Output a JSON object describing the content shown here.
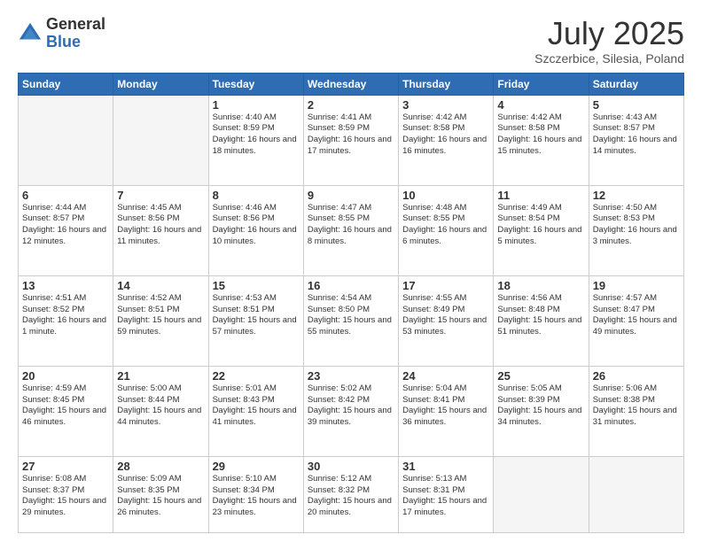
{
  "header": {
    "logo_general": "General",
    "logo_blue": "Blue",
    "month_title": "July 2025",
    "location": "Szczerbice, Silesia, Poland"
  },
  "weekdays": [
    "Sunday",
    "Monday",
    "Tuesday",
    "Wednesday",
    "Thursday",
    "Friday",
    "Saturday"
  ],
  "weeks": [
    [
      {
        "day": "",
        "info": ""
      },
      {
        "day": "",
        "info": ""
      },
      {
        "day": "1",
        "info": "Sunrise: 4:40 AM\nSunset: 8:59 PM\nDaylight: 16 hours\nand 18 minutes."
      },
      {
        "day": "2",
        "info": "Sunrise: 4:41 AM\nSunset: 8:59 PM\nDaylight: 16 hours\nand 17 minutes."
      },
      {
        "day": "3",
        "info": "Sunrise: 4:42 AM\nSunset: 8:58 PM\nDaylight: 16 hours\nand 16 minutes."
      },
      {
        "day": "4",
        "info": "Sunrise: 4:42 AM\nSunset: 8:58 PM\nDaylight: 16 hours\nand 15 minutes."
      },
      {
        "day": "5",
        "info": "Sunrise: 4:43 AM\nSunset: 8:57 PM\nDaylight: 16 hours\nand 14 minutes."
      }
    ],
    [
      {
        "day": "6",
        "info": "Sunrise: 4:44 AM\nSunset: 8:57 PM\nDaylight: 16 hours\nand 12 minutes."
      },
      {
        "day": "7",
        "info": "Sunrise: 4:45 AM\nSunset: 8:56 PM\nDaylight: 16 hours\nand 11 minutes."
      },
      {
        "day": "8",
        "info": "Sunrise: 4:46 AM\nSunset: 8:56 PM\nDaylight: 16 hours\nand 10 minutes."
      },
      {
        "day": "9",
        "info": "Sunrise: 4:47 AM\nSunset: 8:55 PM\nDaylight: 16 hours\nand 8 minutes."
      },
      {
        "day": "10",
        "info": "Sunrise: 4:48 AM\nSunset: 8:55 PM\nDaylight: 16 hours\nand 6 minutes."
      },
      {
        "day": "11",
        "info": "Sunrise: 4:49 AM\nSunset: 8:54 PM\nDaylight: 16 hours\nand 5 minutes."
      },
      {
        "day": "12",
        "info": "Sunrise: 4:50 AM\nSunset: 8:53 PM\nDaylight: 16 hours\nand 3 minutes."
      }
    ],
    [
      {
        "day": "13",
        "info": "Sunrise: 4:51 AM\nSunset: 8:52 PM\nDaylight: 16 hours\nand 1 minute."
      },
      {
        "day": "14",
        "info": "Sunrise: 4:52 AM\nSunset: 8:51 PM\nDaylight: 15 hours\nand 59 minutes."
      },
      {
        "day": "15",
        "info": "Sunrise: 4:53 AM\nSunset: 8:51 PM\nDaylight: 15 hours\nand 57 minutes."
      },
      {
        "day": "16",
        "info": "Sunrise: 4:54 AM\nSunset: 8:50 PM\nDaylight: 15 hours\nand 55 minutes."
      },
      {
        "day": "17",
        "info": "Sunrise: 4:55 AM\nSunset: 8:49 PM\nDaylight: 15 hours\nand 53 minutes."
      },
      {
        "day": "18",
        "info": "Sunrise: 4:56 AM\nSunset: 8:48 PM\nDaylight: 15 hours\nand 51 minutes."
      },
      {
        "day": "19",
        "info": "Sunrise: 4:57 AM\nSunset: 8:47 PM\nDaylight: 15 hours\nand 49 minutes."
      }
    ],
    [
      {
        "day": "20",
        "info": "Sunrise: 4:59 AM\nSunset: 8:45 PM\nDaylight: 15 hours\nand 46 minutes."
      },
      {
        "day": "21",
        "info": "Sunrise: 5:00 AM\nSunset: 8:44 PM\nDaylight: 15 hours\nand 44 minutes."
      },
      {
        "day": "22",
        "info": "Sunrise: 5:01 AM\nSunset: 8:43 PM\nDaylight: 15 hours\nand 41 minutes."
      },
      {
        "day": "23",
        "info": "Sunrise: 5:02 AM\nSunset: 8:42 PM\nDaylight: 15 hours\nand 39 minutes."
      },
      {
        "day": "24",
        "info": "Sunrise: 5:04 AM\nSunset: 8:41 PM\nDaylight: 15 hours\nand 36 minutes."
      },
      {
        "day": "25",
        "info": "Sunrise: 5:05 AM\nSunset: 8:39 PM\nDaylight: 15 hours\nand 34 minutes."
      },
      {
        "day": "26",
        "info": "Sunrise: 5:06 AM\nSunset: 8:38 PM\nDaylight: 15 hours\nand 31 minutes."
      }
    ],
    [
      {
        "day": "27",
        "info": "Sunrise: 5:08 AM\nSunset: 8:37 PM\nDaylight: 15 hours\nand 29 minutes."
      },
      {
        "day": "28",
        "info": "Sunrise: 5:09 AM\nSunset: 8:35 PM\nDaylight: 15 hours\nand 26 minutes."
      },
      {
        "day": "29",
        "info": "Sunrise: 5:10 AM\nSunset: 8:34 PM\nDaylight: 15 hours\nand 23 minutes."
      },
      {
        "day": "30",
        "info": "Sunrise: 5:12 AM\nSunset: 8:32 PM\nDaylight: 15 hours\nand 20 minutes."
      },
      {
        "day": "31",
        "info": "Sunrise: 5:13 AM\nSunset: 8:31 PM\nDaylight: 15 hours\nand 17 minutes."
      },
      {
        "day": "",
        "info": ""
      },
      {
        "day": "",
        "info": ""
      }
    ]
  ]
}
